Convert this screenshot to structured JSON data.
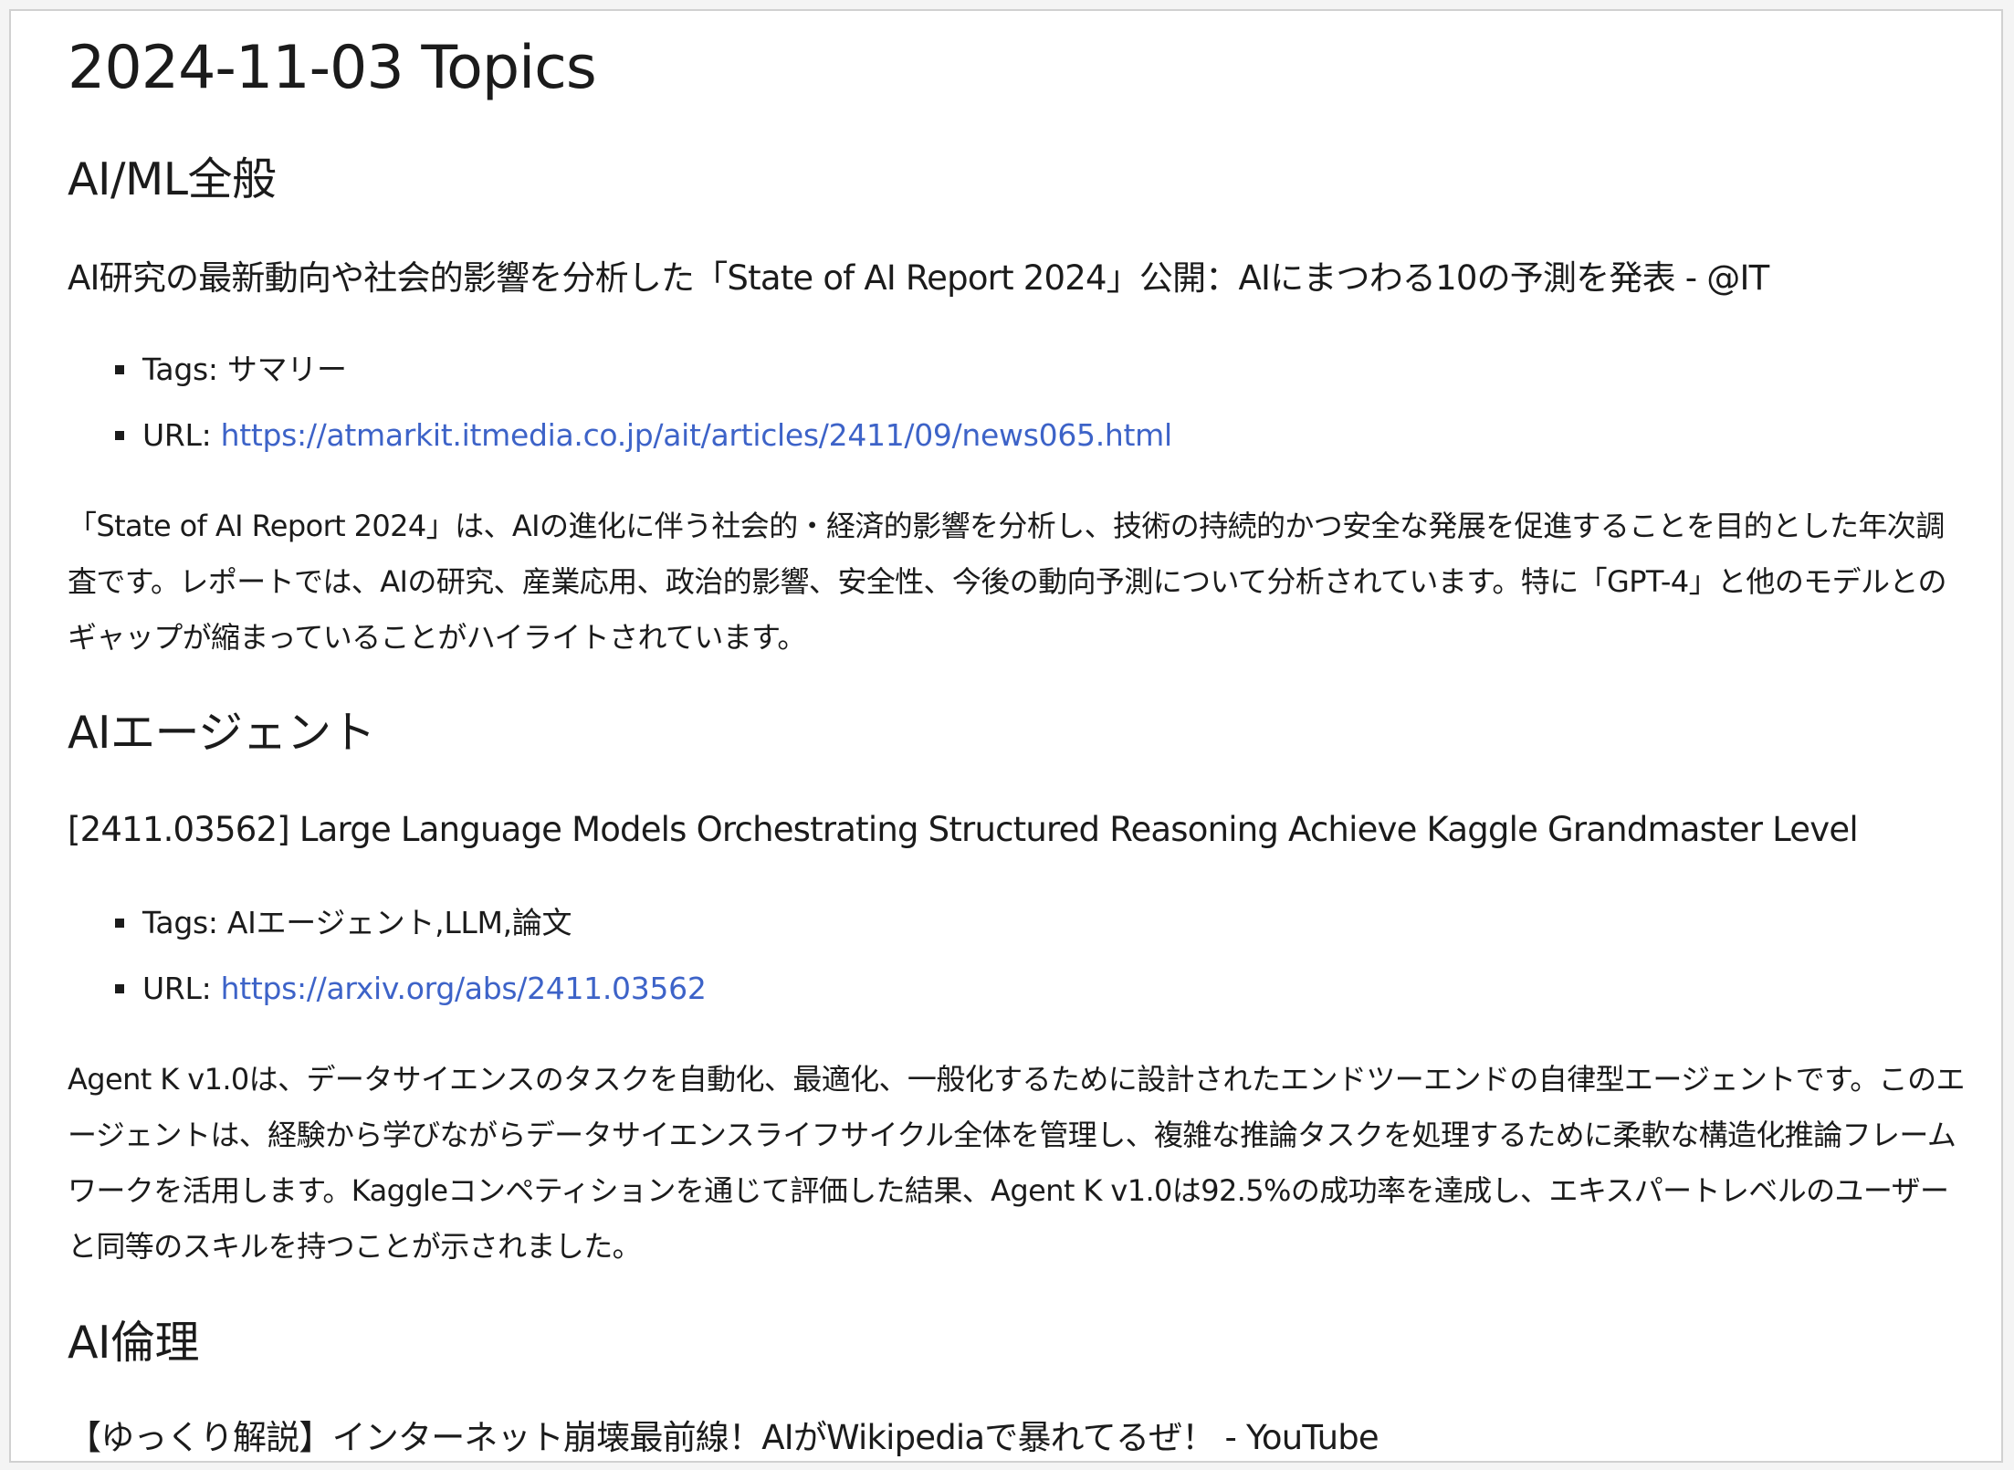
{
  "title": "2024-11-03 Topics",
  "sections": [
    {
      "heading": "AI/ML全般",
      "article": {
        "title": "AI研究の最新動向や社会的影響を分析した「State of AI Report 2024」公開：AIにまつわる10の予測を発表 - @IT",
        "tags_label": "Tags:",
        "tags": "サマリー",
        "url_label": "URL:",
        "url": "https://atmarkit.itmedia.co.jp/ait/articles/2411/09/news065.html",
        "summary": "「State of AI Report 2024」は、AIの進化に伴う社会的・経済的影響を分析し、技術の持続的かつ安全な発展を促進することを目的とした年次調査です。レポートでは、AIの研究、産業応用、政治的影響、安全性、今後の動向予測について分析されています。特に「GPT-4」と他のモデルとのギャップが縮まっていることがハイライトされています。"
      }
    },
    {
      "heading": "AIエージェント",
      "article": {
        "title": "[2411.03562] Large Language Models Orchestrating Structured Reasoning Achieve Kaggle Grandmaster Level",
        "tags_label": "Tags:",
        "tags": "AIエージェント,LLM,論文",
        "url_label": "URL:",
        "url": "https://arxiv.org/abs/2411.03562",
        "summary": "Agent K v1.0は、データサイエンスのタスクを自動化、最適化、一般化するために設計されたエンドツーエンドの自律型エージェントです。このエージェントは、経験から学びながらデータサイエンスライフサイクル全体を管理し、複雑な推論タスクを処理するために柔軟な構造化推論フレームワークを活用します。Kaggleコンペティションを通じて評価した結果、Agent K v1.0は92.5%の成功率を達成し、エキスパートレベルのユーザーと同等のスキルを持つことが示されました。"
      }
    },
    {
      "heading": "AI倫理",
      "article": {
        "title": "【ゆっくり解説】インターネット崩壊最前線！AIがWikipediaで暴れてるぜ！ - YouTube"
      }
    }
  ]
}
